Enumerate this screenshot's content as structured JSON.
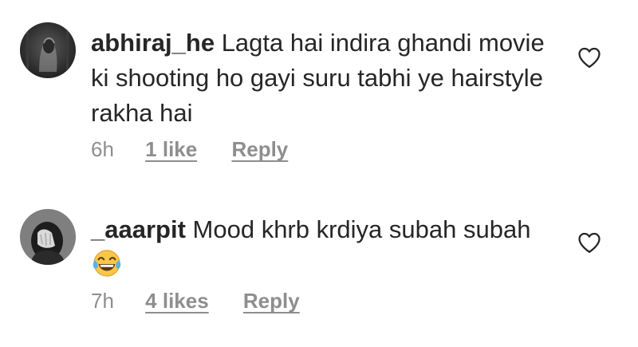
{
  "comments": [
    {
      "username": "abhiraj_he",
      "text": "Lagta hai indira ghandi movie ki shooting ho gayi suru tabhi ye hairstyle rakha hai",
      "time": "6h",
      "likes": "1 like",
      "reply_label": "Reply",
      "avatar_icon": "hooded-figure-avatar",
      "like_icon": "heart-outline-icon"
    },
    {
      "username": "_aaarpit",
      "text": "Mood khrb krdiya subah subah",
      "emoji": "face-with-tears-of-joy",
      "time": "7h",
      "likes": "4 likes",
      "reply_label": "Reply",
      "avatar_icon": "person-covering-face-avatar",
      "like_icon": "heart-outline-icon"
    }
  ],
  "colors": {
    "text": "#262626",
    "secondary": "#8e8e8e",
    "background": "#ffffff"
  }
}
